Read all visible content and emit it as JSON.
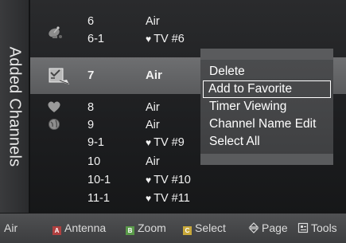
{
  "side_title": "Added Channels",
  "colors": {
    "highlight": "#5e5f61",
    "popup": "#454648",
    "bottom_bar": "#474849"
  },
  "channels": [
    {
      "number": "6",
      "name": "Air",
      "favorite": false,
      "icon": "antenna-icon"
    },
    {
      "number": "6-1",
      "name": "TV #6",
      "favorite": true,
      "icon": ""
    },
    {
      "number": "7",
      "name": "Air",
      "favorite": false,
      "icon": "edit-checklist-icon",
      "selected": true
    },
    {
      "number": "8",
      "name": "Air",
      "favorite": false,
      "icon": "heart-icon"
    },
    {
      "number": "9",
      "name": "Air",
      "favorite": false,
      "icon": "globe-icon"
    },
    {
      "number": "9-1",
      "name": "TV #9",
      "favorite": true,
      "icon": ""
    },
    {
      "number": "10",
      "name": "Air",
      "favorite": false,
      "icon": ""
    },
    {
      "number": "10-1",
      "name": "TV #10",
      "favorite": true,
      "icon": ""
    },
    {
      "number": "11-1",
      "name": "TV #11",
      "favorite": true,
      "icon": ""
    }
  ],
  "heart_glyph": "♥",
  "popup_menu": {
    "items": [
      "Delete",
      "Add to Favorite",
      "Timer Viewing",
      "Channel Name Edit",
      "Select All"
    ],
    "active_item": "Add to Favorite"
  },
  "bottom_bar": {
    "mode": "Air",
    "items": [
      {
        "key": "A",
        "label": "Antenna"
      },
      {
        "key": "B",
        "label": "Zoom"
      },
      {
        "key": "C",
        "label": "Select"
      },
      {
        "label": "Page",
        "icon": "up-down-arrows-icon"
      },
      {
        "label": "Tools",
        "icon": "tools-icon"
      }
    ]
  }
}
